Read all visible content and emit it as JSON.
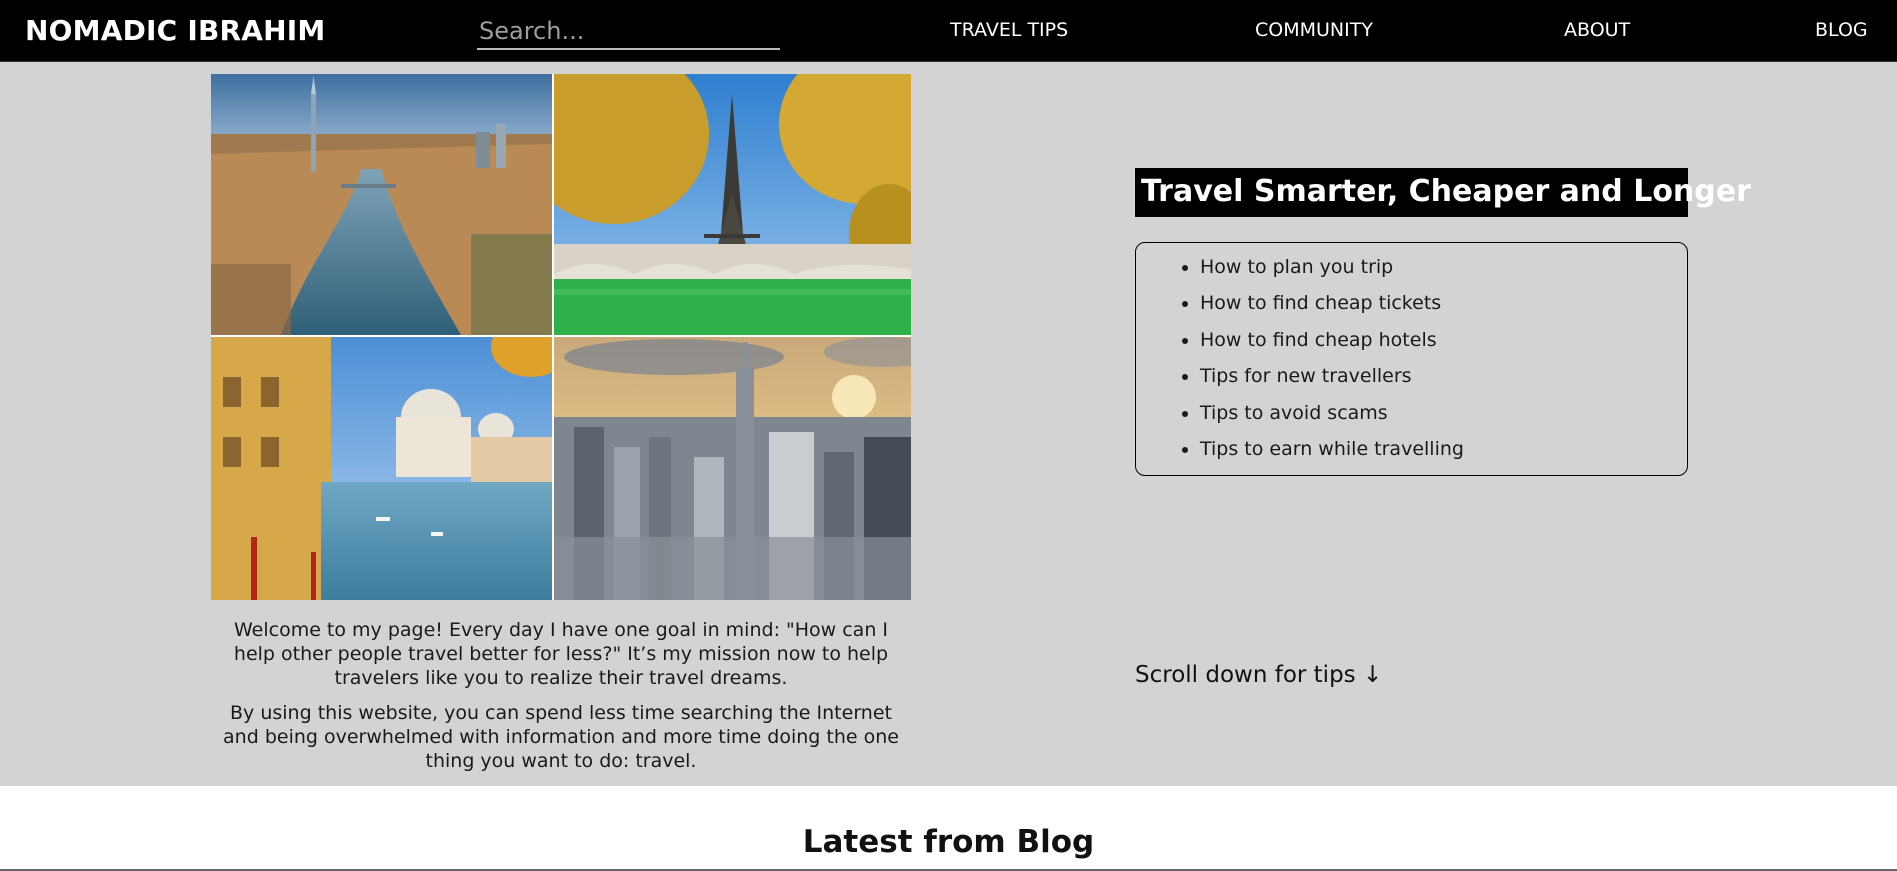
{
  "nav": {
    "brand": "NOMADIC IBRAHIM",
    "search_placeholder": "Search...",
    "links": [
      "TRAVEL TIPS",
      "COMMUNITY",
      "ABOUT",
      "BLOG"
    ]
  },
  "hero": {
    "photos": [
      {
        "name": "london-photo"
      },
      {
        "name": "paris-photo"
      },
      {
        "name": "venice-photo"
      },
      {
        "name": "new-york-photo"
      }
    ],
    "intro_paragraphs": [
      "Welcome to my page! Every day I have one goal in mind: \"How can I help other people travel better for less?\" It’s my mission now to help travelers like you to realize their travel dreams.",
      "By using this website, you can spend less time searching the Internet and being overwhelmed with information and more time doing the one thing you want to do: travel."
    ],
    "tips_title": "Travel Smarter, Cheaper and Longer",
    "tips": [
      "How to plan you trip",
      "How to find cheap tickets",
      "How to find cheap hotels",
      "Tips for new travellers",
      "Tips to avoid scams",
      "Tips to earn while travelling"
    ],
    "scroll_hint": "Scroll down for tips ↓"
  },
  "blog": {
    "title": "Latest from Blog"
  },
  "colors": {
    "nav_background": "#000000",
    "hero_background": "#d3d3d3",
    "text": "#111111"
  }
}
